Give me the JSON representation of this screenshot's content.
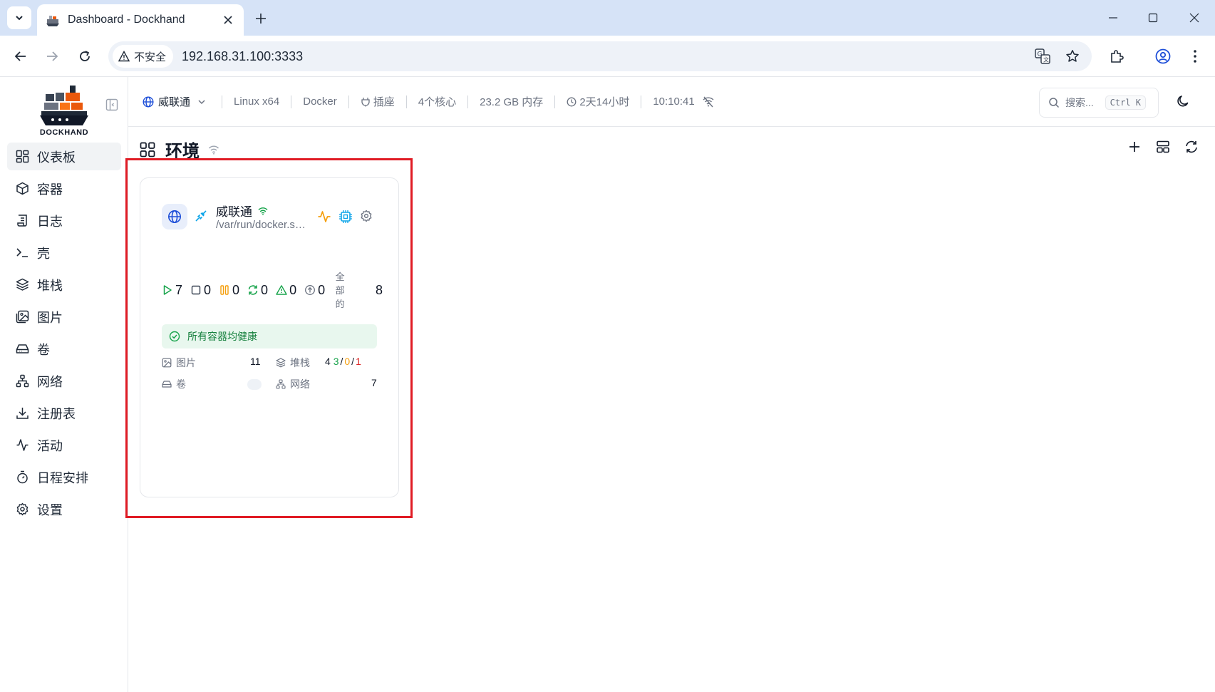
{
  "browser": {
    "tab_title": "Dashboard - Dockhand",
    "security_label": "不安全",
    "url": "192.168.31.100:3333"
  },
  "sidebar": {
    "logo_text": "DOCKHAND",
    "items": [
      {
        "label": "仪表板",
        "icon": "dashboard-icon",
        "active": true
      },
      {
        "label": "容器",
        "icon": "box-icon"
      },
      {
        "label": "日志",
        "icon": "scroll-icon"
      },
      {
        "label": "壳",
        "icon": "terminal-icon"
      },
      {
        "label": "堆栈",
        "icon": "layers-icon"
      },
      {
        "label": "图片",
        "icon": "images-icon"
      },
      {
        "label": "卷",
        "icon": "hard-drive-icon"
      },
      {
        "label": "网络",
        "icon": "network-icon"
      },
      {
        "label": "注册表",
        "icon": "download-icon"
      },
      {
        "label": "活动",
        "icon": "activity-icon"
      },
      {
        "label": "日程安排",
        "icon": "timer-icon"
      },
      {
        "label": "设置",
        "icon": "gear-icon"
      }
    ]
  },
  "topbar": {
    "environment": "威联通",
    "os": "Linux x64",
    "engine": "Docker",
    "socket": "插座",
    "cores": "4个核心",
    "memory": "23.2 GB 内存",
    "uptime": "2天14小时",
    "time": "10:10:41",
    "search_placeholder": "搜索...",
    "search_shortcut": "Ctrl K"
  },
  "page": {
    "title": "环境"
  },
  "card": {
    "name": "威联通",
    "path": "/var/run/docker.sock",
    "stats": {
      "running": "7",
      "stopped": "0",
      "paused": "0",
      "restarting": "0",
      "unhealthy": "0",
      "pending": "0",
      "total_label": "全部的",
      "total": "8"
    },
    "health_text": "所有容器均健康",
    "images_label": "图片",
    "images_value": "11",
    "stacks_label": "堆栈",
    "stacks_total": "4",
    "stacks_running": "3",
    "stacks_partial": "0",
    "stacks_stopped": "1",
    "slash": "/",
    "volumes_label": "卷",
    "networks_label": "网络",
    "networks_value": "7"
  },
  "colors": {
    "highlight": "#e01b24",
    "running": "#16a34a",
    "paused": "#f59e0b",
    "health_bg": "#e8f7ee",
    "accent": "#1d4ed8"
  }
}
